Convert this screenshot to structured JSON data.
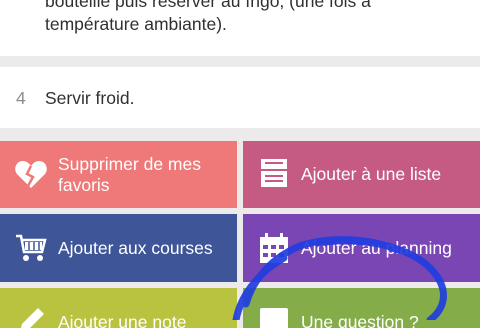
{
  "steps": {
    "prev": {
      "text": "bouteille puis réserver au frigo, (une fois à température ambiante)."
    },
    "step4": {
      "number": "4",
      "text": "Servir froid."
    }
  },
  "actions": {
    "remove_favorite": {
      "label": "Supprimer de mes favoris",
      "icon": "broken-heart-icon",
      "color": "#ef7878"
    },
    "add_list": {
      "label": "Ajouter à une liste",
      "icon": "recipe-box-icon",
      "color": "#c55a83"
    },
    "add_shopping": {
      "label": "Ajouter aux courses",
      "icon": "shopping-cart-icon",
      "color": "#3e5598"
    },
    "add_planning": {
      "label": "Ajouter au planning",
      "icon": "calendar-icon",
      "color": "#7a46b3"
    },
    "add_note": {
      "label": "Ajouter une note",
      "icon": "pencil-icon",
      "color": "#b9c340"
    },
    "question": {
      "label": "Une question ?",
      "icon": "chat-icon",
      "color": "#84ad4a"
    }
  },
  "annotation": {
    "color": "#1f3de0"
  }
}
